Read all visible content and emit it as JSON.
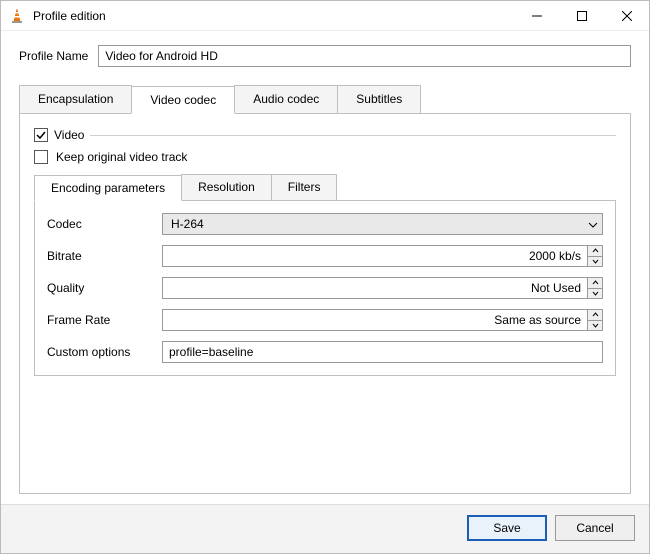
{
  "window": {
    "title": "Profile edition"
  },
  "profile": {
    "name_label": "Profile Name",
    "name_value": "Video for Android HD"
  },
  "tabs": {
    "encapsulation": "Encapsulation",
    "video_codec": "Video codec",
    "audio_codec": "Audio codec",
    "subtitles": "Subtitles",
    "active": "video_codec"
  },
  "video_group": {
    "checkbox_label": "Video",
    "checkbox_checked": true,
    "keep_original_label": "Keep original video track",
    "keep_original_checked": false
  },
  "inner_tabs": {
    "encoding": "Encoding parameters",
    "resolution": "Resolution",
    "filters": "Filters",
    "active": "encoding"
  },
  "encoding": {
    "codec_label": "Codec",
    "codec_value": "H-264",
    "bitrate_label": "Bitrate",
    "bitrate_value": "2000 kb/s",
    "quality_label": "Quality",
    "quality_value": "Not Used",
    "framerate_label": "Frame Rate",
    "framerate_value": "Same as source",
    "custom_label": "Custom options",
    "custom_value": "profile=baseline"
  },
  "footer": {
    "save": "Save",
    "cancel": "Cancel"
  },
  "icons": {
    "app": "vlc-cone"
  }
}
